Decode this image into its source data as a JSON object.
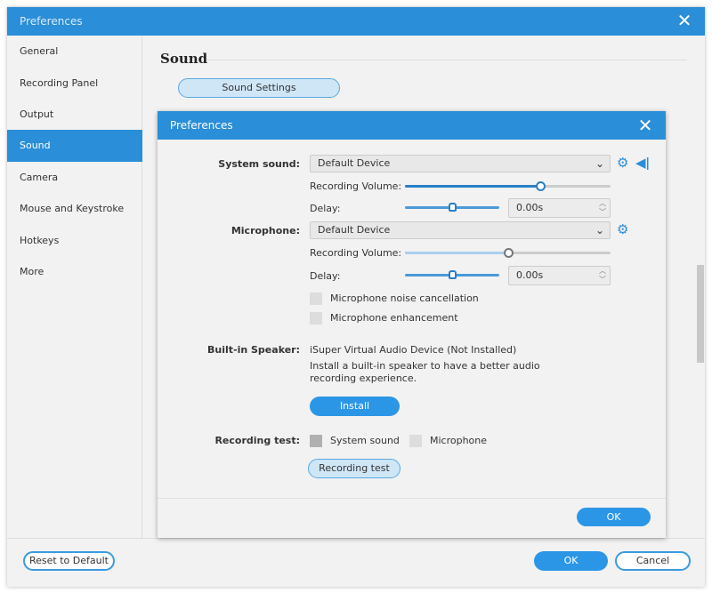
{
  "outer": {
    "title": "Preferences",
    "sidebar": [
      "General",
      "Recording Panel",
      "Output",
      "Sound",
      "Camera",
      "Mouse and Keystroke",
      "Hotkeys",
      "More"
    ],
    "selected": "Sound",
    "section_title": "Sound",
    "sound_settings_label": "Sound Settings",
    "reset_label": "Reset to Default",
    "ok_label": "OK",
    "cancel_label": "Cancel"
  },
  "dialog": {
    "title": "Preferences",
    "system_sound": {
      "label": "System sound:",
      "device": "Default Device",
      "volume_label": "Recording Volume:",
      "volume_percent": 66,
      "delay_label": "Delay:",
      "delay_value": "0.00s",
      "delay_percent": 50
    },
    "microphone": {
      "label": "Microphone:",
      "device": "Default Device",
      "volume_label": "Recording Volume:",
      "volume_percent": 50,
      "delay_label": "Delay:",
      "delay_value": "0.00s",
      "delay_percent": 50,
      "noise_cancellation": "Microphone noise cancellation",
      "enhancement": "Microphone enhancement"
    },
    "speaker": {
      "label": "Built-in Speaker:",
      "device": "iSuper Virtual Audio Device (Not Installed)",
      "description": "Install a built-in speaker to have a better audio recording experience.",
      "install_label": "Install"
    },
    "test": {
      "label": "Recording test:",
      "system_sound": "System sound",
      "microphone": "Microphone",
      "button": "Recording test"
    },
    "ok_label": "OK"
  },
  "colors": {
    "accent": "#2a8ed8"
  }
}
